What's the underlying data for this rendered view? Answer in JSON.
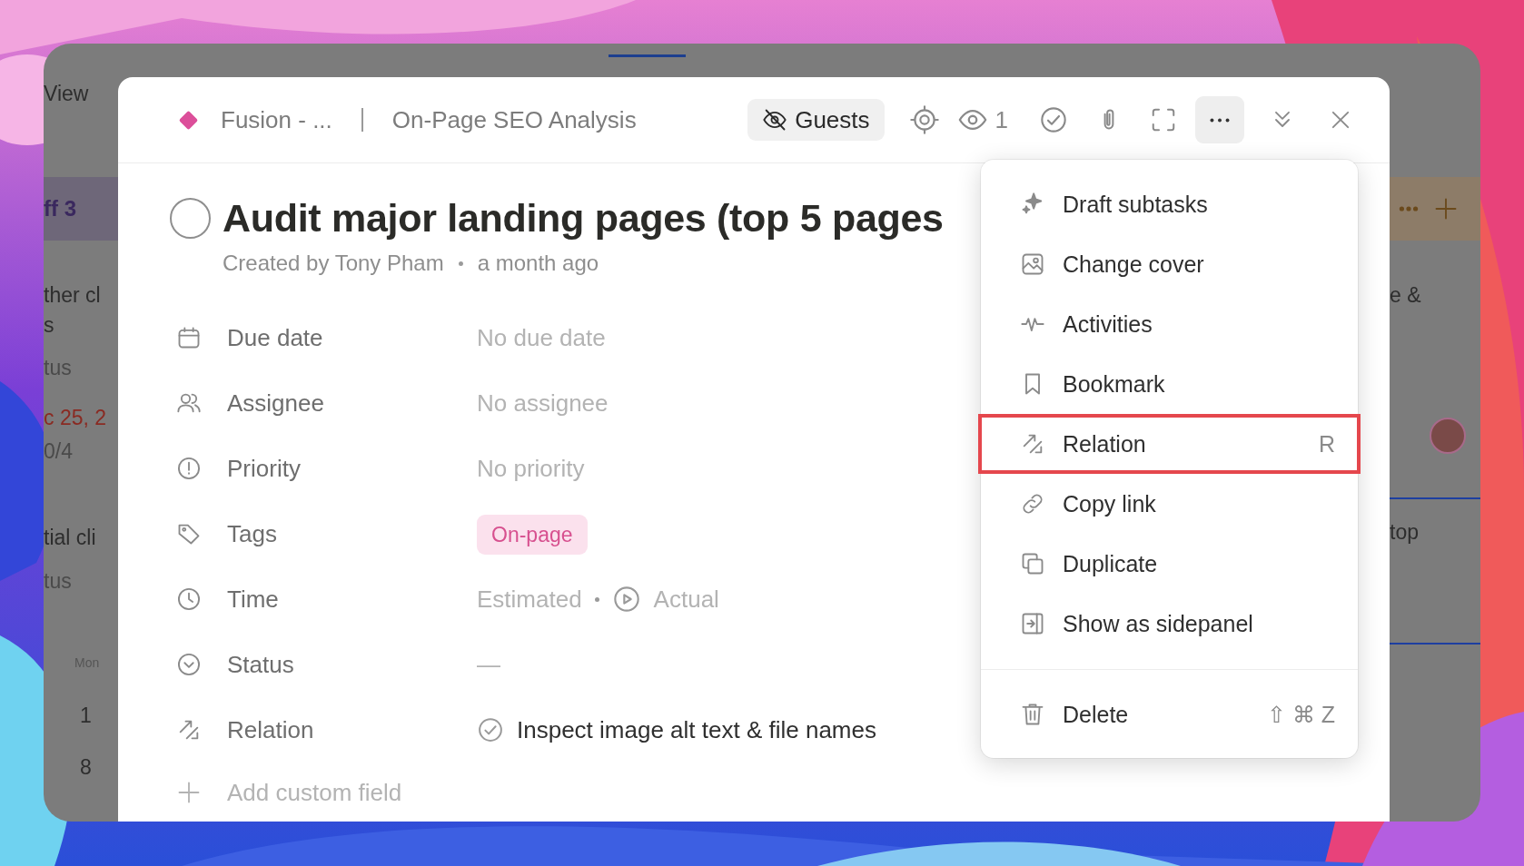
{
  "background_app": {
    "left": [
      {
        "text": "View",
        "kind": "toolbar"
      },
      {
        "text": "ff 3",
        "kind": "group"
      },
      {
        "text": "ther cl",
        "kind": "title"
      },
      {
        "text": "s",
        "kind": "title"
      },
      {
        "text": "tus",
        "kind": "muted"
      },
      {
        "text": "c 25, 2",
        "kind": "date"
      },
      {
        "text": "0/4",
        "kind": "muted"
      },
      {
        "text": "tial cli",
        "kind": "title"
      },
      {
        "text": "tus",
        "kind": "muted"
      },
      {
        "text": "Mon",
        "kind": "weekday"
      },
      {
        "text": "1",
        "kind": "day"
      },
      {
        "text": "8",
        "kind": "day"
      }
    ],
    "right": [
      {
        "text": "e &",
        "kind": "title"
      },
      {
        "text": "top",
        "kind": "card"
      }
    ]
  },
  "header": {
    "space": "Fusion - ...",
    "list": "On-Page SEO Analysis",
    "guests": "Guests",
    "watchers": "1"
  },
  "task": {
    "completed": false,
    "title": "Audit major landing pages (top 5 pages",
    "created_by": "Created by Tony Pham",
    "created_at": "a month ago",
    "fields": [
      {
        "label": "Due date",
        "kind": "empty",
        "placeholder": "No due date"
      },
      {
        "label": "Assignee",
        "kind": "empty",
        "placeholder": "No assignee"
      },
      {
        "label": "Priority",
        "kind": "empty",
        "placeholder": "No priority"
      },
      {
        "label": "Tags",
        "kind": "tag",
        "value": "On-page"
      },
      {
        "label": "Time",
        "kind": "time",
        "estimated": "Estimated",
        "actual": "Actual"
      },
      {
        "label": "Status",
        "kind": "status",
        "value": "—"
      },
      {
        "label": "Relation",
        "kind": "relation",
        "value": "Inspect image alt text & file names"
      }
    ],
    "add_field": "Add custom field"
  },
  "menu": {
    "items": [
      {
        "label": "Draft subtasks",
        "selected": false
      },
      {
        "label": "Change cover",
        "selected": false
      },
      {
        "label": "Activities",
        "selected": false
      },
      {
        "label": "Bookmark",
        "selected": false
      },
      {
        "label": "Relation",
        "selected": true,
        "shortcut": "R"
      },
      {
        "label": "Copy link",
        "selected": false
      },
      {
        "label": "Duplicate",
        "selected": false
      },
      {
        "label": "Show as sidepanel",
        "selected": false
      }
    ],
    "delete": {
      "label": "Delete",
      "shortcut": "⇧ ⌘ Z"
    }
  }
}
